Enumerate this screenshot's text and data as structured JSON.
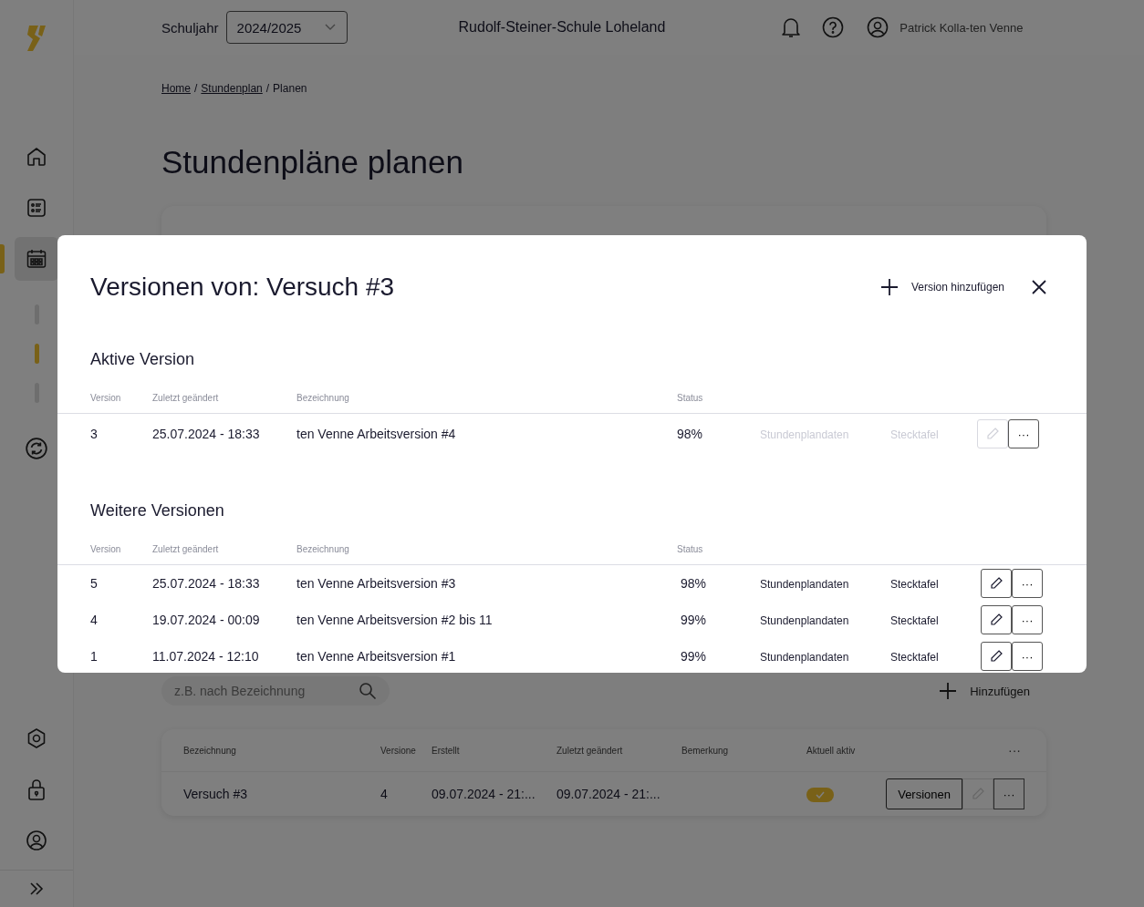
{
  "header": {
    "school_year_label": "Schuljahr",
    "school_year": "2024/2025",
    "school": "Rudolf-Steiner-Schule Loheland",
    "user": "Patrick Kolla-ten Venne"
  },
  "sidebar": {
    "items": [
      {
        "selected": false
      },
      {
        "selected": false
      },
      {
        "selected": true
      }
    ],
    "subitems": [
      {
        "selected": false
      },
      {
        "selected": true
      },
      {
        "selected": false
      }
    ]
  },
  "breadcrumb": [
    {
      "label": "Home",
      "link": true
    },
    {
      "separator": "/",
      "label": "Stundenplan",
      "link": true
    },
    {
      "separator": "/",
      "label": "Planen",
      "link": false
    }
  ],
  "page_title": "Stundenpläne planen",
  "search": {
    "placeholder": "z.B. nach Bezeichnung"
  },
  "add_button": "Hinzufügen",
  "table": {
    "columns": [
      "Bezeichnung",
      "Versione",
      "Erstellt",
      "Zuletzt geändert",
      "Bemerkung",
      "Aktuell aktiv"
    ],
    "more": "···",
    "rows": [
      {
        "name": "Versuch #3",
        "versions": "4",
        "created": "09.07.2024 - 21:...",
        "modified": "09.07.2024 - 21:...",
        "active": true,
        "versions_button": "Versionen",
        "more": "···"
      }
    ]
  },
  "modal": {
    "title": "Versionen von: Versuch #3",
    "add_label": "Version hinzufügen",
    "sections": [
      {
        "title": "Aktive Version",
        "columns": [
          "Version",
          "Zuletzt geändert",
          "Bezeichnung",
          "Status"
        ],
        "rows": [
          {
            "version": "3",
            "modified": "25.07.2024 - 18:33",
            "name": "ten Venne Arbeitsversion #4",
            "status": "98%",
            "data_link": "Stundenplandaten",
            "board_link": "Stecktafel",
            "disabled": true,
            "more": "···"
          }
        ]
      },
      {
        "title": "Weitere Versionen",
        "columns": [
          "Version",
          "Zuletzt geändert",
          "Bezeichnung",
          "Status"
        ],
        "rows": [
          {
            "version": "5",
            "modified": "25.07.2024 - 18:33",
            "name": "ten Venne Arbeitsversion #3",
            "status": "98%",
            "data_link": "Stundenplandaten",
            "board_link": "Stecktafel",
            "disabled": false,
            "more": "···"
          },
          {
            "version": "4",
            "modified": "19.07.2024 - 00:09",
            "name": "ten Venne Arbeitsversion #2 bis 11",
            "status": "99%",
            "data_link": "Stundenplandaten",
            "board_link": "Stecktafel",
            "disabled": false,
            "more": "···"
          },
          {
            "version": "1",
            "modified": "11.07.2024 - 12:10",
            "name": "ten Venne Arbeitsversion #1",
            "status": "99%",
            "data_link": "Stundenplandaten",
            "board_link": "Stecktafel",
            "disabled": false,
            "more": "···"
          }
        ]
      }
    ]
  }
}
